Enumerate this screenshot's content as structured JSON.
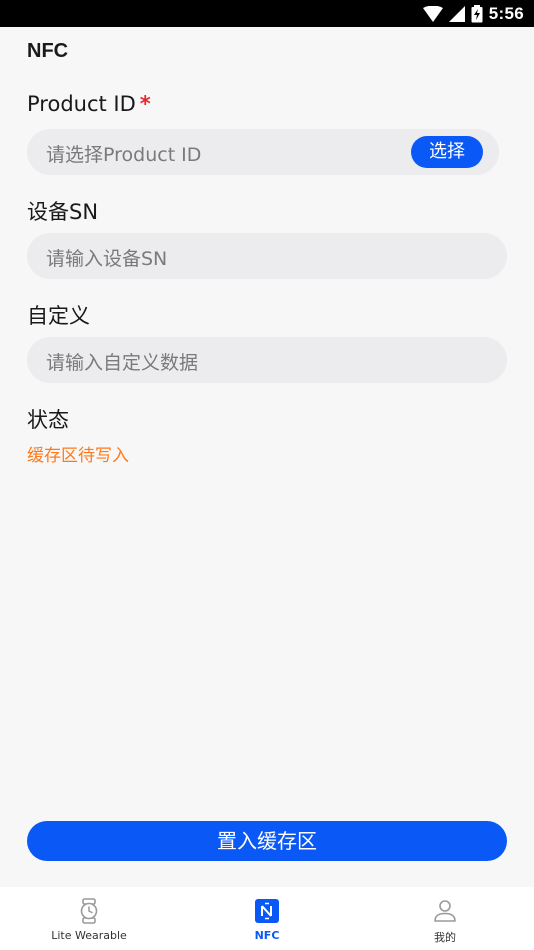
{
  "status_bar": {
    "time": "5:56"
  },
  "page": {
    "title": "NFC"
  },
  "form": {
    "product_id": {
      "label": "Product ID",
      "required_mark": "*",
      "placeholder": "请选择Product ID",
      "button_label": "选择"
    },
    "device_sn": {
      "label": "设备SN",
      "placeholder": "请输入设备SN"
    },
    "custom": {
      "label": "自定义",
      "placeholder": "请输入自定义数据"
    },
    "status": {
      "label": "状态",
      "value": "缓存区待写入"
    }
  },
  "actions": {
    "primary_label": "置入缓存区"
  },
  "tabs": [
    {
      "label": "Lite Wearable",
      "icon": "watch-icon",
      "active": false
    },
    {
      "label": "NFC",
      "icon": "nfc-icon",
      "active": true
    },
    {
      "label": "我的",
      "icon": "person-icon",
      "active": false
    }
  ],
  "colors": {
    "accent": "#0a59f7",
    "status_text": "#ff7a1a",
    "required": "#e8262c"
  }
}
